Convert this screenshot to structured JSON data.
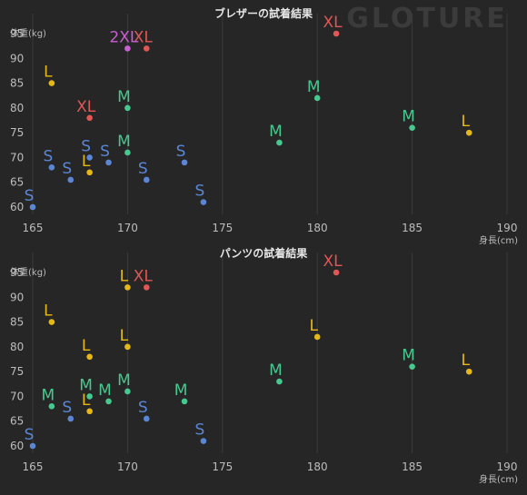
{
  "watermark": "GLOTURE",
  "colors": {
    "background": "#262626",
    "grid": "#3a3a3a",
    "axis_text": "#bdbdbd",
    "title_text": "#e6e6e6",
    "S": "#5b86d4",
    "M": "#46c98f",
    "L": "#e6b817",
    "XL": "#e05757",
    "2XL": "#c85fd2"
  },
  "chart_data": [
    {
      "type": "scatter",
      "title": "ブレザーの試着結果",
      "xlabel": "身長(cm)",
      "ylabel": "体重(kg)",
      "xlim": [
        165,
        190
      ],
      "ylim": [
        60,
        95
      ],
      "xticks": [
        "165",
        "170",
        "175",
        "180",
        "185",
        "190"
      ],
      "yticks": [
        "60",
        "65",
        "70",
        "75",
        "80",
        "85",
        "90",
        "95"
      ],
      "grid": true,
      "points": [
        {
          "x": 165,
          "y": 60,
          "size": "S"
        },
        {
          "x": 166,
          "y": 68,
          "size": "S"
        },
        {
          "x": 167,
          "y": 65.5,
          "size": "S"
        },
        {
          "x": 168,
          "y": 70,
          "size": "S"
        },
        {
          "x": 169,
          "y": 69,
          "size": "S"
        },
        {
          "x": 171,
          "y": 65.5,
          "size": "S"
        },
        {
          "x": 173,
          "y": 69,
          "size": "S"
        },
        {
          "x": 174,
          "y": 61,
          "size": "S"
        },
        {
          "x": 168,
          "y": 67,
          "size": "L"
        },
        {
          "x": 166,
          "y": 85,
          "size": "L"
        },
        {
          "x": 188,
          "y": 75,
          "size": "L"
        },
        {
          "x": 170,
          "y": 71,
          "size": "M"
        },
        {
          "x": 170,
          "y": 80,
          "size": "M"
        },
        {
          "x": 178,
          "y": 73,
          "size": "M"
        },
        {
          "x": 180,
          "y": 82,
          "size": "M"
        },
        {
          "x": 185,
          "y": 76,
          "size": "M"
        },
        {
          "x": 168,
          "y": 78,
          "size": "XL"
        },
        {
          "x": 171,
          "y": 92,
          "size": "XL"
        },
        {
          "x": 181,
          "y": 95,
          "size": "XL"
        },
        {
          "x": 170,
          "y": 92,
          "size": "2XL"
        }
      ]
    },
    {
      "type": "scatter",
      "title": "パンツの試着結果",
      "xlabel": "身長(cm)",
      "ylabel": "体重(kg)",
      "xlim": [
        165,
        190
      ],
      "ylim": [
        60,
        95
      ],
      "xticks": [
        "165",
        "170",
        "175",
        "180",
        "185",
        "190"
      ],
      "yticks": [
        "60",
        "65",
        "70",
        "75",
        "80",
        "85",
        "90",
        "95"
      ],
      "grid": true,
      "points": [
        {
          "x": 165,
          "y": 60,
          "size": "S"
        },
        {
          "x": 167,
          "y": 65.5,
          "size": "S"
        },
        {
          "x": 171,
          "y": 65.5,
          "size": "S"
        },
        {
          "x": 174,
          "y": 61,
          "size": "S"
        },
        {
          "x": 166,
          "y": 68,
          "size": "M"
        },
        {
          "x": 168,
          "y": 70,
          "size": "M"
        },
        {
          "x": 169,
          "y": 69,
          "size": "M"
        },
        {
          "x": 170,
          "y": 71,
          "size": "M"
        },
        {
          "x": 173,
          "y": 69,
          "size": "M"
        },
        {
          "x": 178,
          "y": 73,
          "size": "M"
        },
        {
          "x": 185,
          "y": 76,
          "size": "M"
        },
        {
          "x": 168,
          "y": 67,
          "size": "L"
        },
        {
          "x": 166,
          "y": 85,
          "size": "L"
        },
        {
          "x": 168,
          "y": 78,
          "size": "L"
        },
        {
          "x": 170,
          "y": 80,
          "size": "L"
        },
        {
          "x": 170,
          "y": 92,
          "size": "L"
        },
        {
          "x": 180,
          "y": 82,
          "size": "L"
        },
        {
          "x": 188,
          "y": 75,
          "size": "L"
        },
        {
          "x": 171,
          "y": 92,
          "size": "XL"
        },
        {
          "x": 181,
          "y": 95,
          "size": "XL"
        }
      ]
    }
  ]
}
